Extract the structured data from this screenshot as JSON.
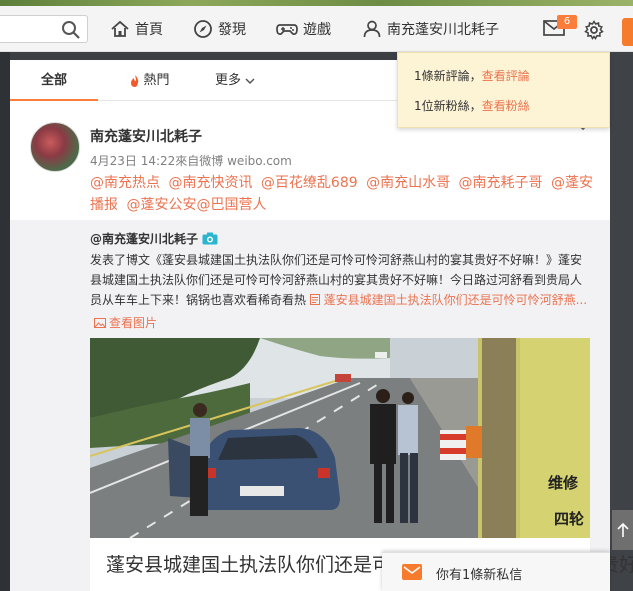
{
  "topnav": {
    "home_label": "首頁",
    "discover_label": "發現",
    "games_label": "遊戲",
    "user_label": "南充蓬安川北耗子",
    "mail_badge": "6"
  },
  "tabs": {
    "all": "全部",
    "hot": "熱門",
    "more": "更多"
  },
  "post": {
    "author": "南充蓬安川北耗子",
    "meta": "4月23日 14:22來自微博 weibo.com",
    "mentions": [
      "@南充热点",
      "@南充快资讯",
      "@百花缭乱689",
      "@南充山水哥",
      "@南充耗子哥",
      "@蓬安播报",
      "@蓬安公安@巴国营人"
    ],
    "repost": {
      "author": "@南充蓬安川北耗子",
      "text": "发表了博文《蓬安县城建国土执法队你们还是可怜可怜河舒燕山村的宴其贵好不好嘛！》蓬安县城建国土执法队你们还是可怜可怜河舒燕山村的宴其贵好不好嘛！今日路过河舒看到贵局人员从车车上下来！锅锅也喜欢看稀奇看热",
      "link_text": "蓬安县城建国土执法队你们还是可怜可怜河舒燕...",
      "view_pics": "查看图片",
      "card_title": "蓬安县城建国土执法队你们还是可怜可怜河舒燕山村的宴其贵好..."
    }
  },
  "notify": {
    "comments_text": "1條新評論，",
    "comments_link": "查看評論",
    "fans_text": "1位新粉絲，",
    "fans_link": "查看粉絲"
  },
  "pm_toast": {
    "text": "你有1條新私信"
  },
  "colors": {
    "accent": "#fa7d3c",
    "link": "#eb7350"
  }
}
